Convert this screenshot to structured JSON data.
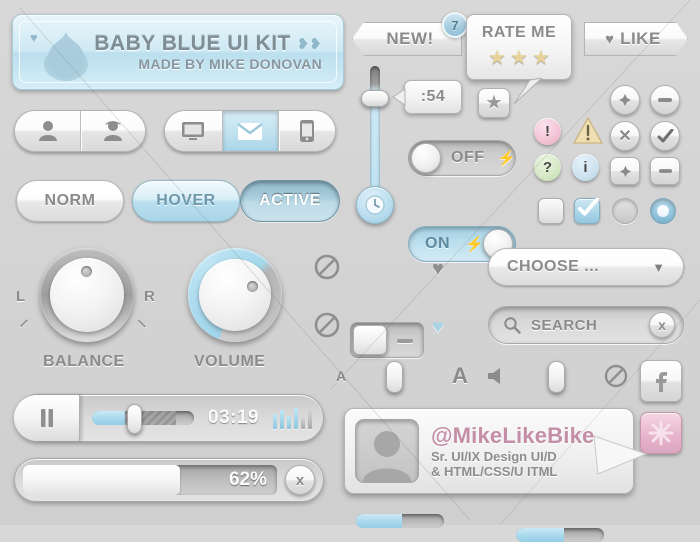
{
  "banner": {
    "title": "BABY BLUE UI KIT",
    "subtitle": "MADE BY MIKE DONOVAN",
    "heart_left": "heart-icon",
    "heart_right": "hearts-icon"
  },
  "tags": {
    "new_label": "NEW!",
    "new_badge": "7",
    "like_label": "LIKE",
    "like_heart": "♥"
  },
  "rate_popover": {
    "title": "RATE ME",
    "stars": [
      "★",
      "★",
      "★"
    ],
    "trigger_icon": "star-icon"
  },
  "timer": {
    "tooltip": ":54",
    "clock_icon": "clock-icon"
  },
  "toggles": {
    "off_label": "OFF",
    "on_label": "ON",
    "bolt": "⚡"
  },
  "states": {
    "norm": "NORM",
    "hover": "HOVER",
    "active": "ACTIVE"
  },
  "segments": {
    "users": [
      "user-icon",
      "user-female-icon"
    ],
    "devices": [
      "monitor-icon",
      "envelope-icon",
      "smartphone-icon"
    ],
    "device_active_index": 1
  },
  "knobs": [
    {
      "label": "BALANCE",
      "left_mark": "L",
      "right_mark": "R",
      "value": 50
    },
    {
      "label": "VOLUME",
      "left_mark": "",
      "right_mark": "",
      "value": 72
    }
  ],
  "icon_grid": {
    "circles": [
      "plus-icon",
      "minus-icon",
      "close-icon",
      "check-icon"
    ],
    "squares": [
      "plus-icon",
      "minus-icon"
    ],
    "radios": [
      "radio-off",
      "radio-on"
    ]
  },
  "alerts": [
    {
      "name": "error-icon",
      "glyph": "!",
      "color": "#f2c3d4"
    },
    {
      "name": "warning-icon",
      "glyph": "!",
      "color": "#f0dfb0"
    },
    {
      "name": "help-icon",
      "glyph": "?",
      "color": "#d5e8c4"
    },
    {
      "name": "info-icon",
      "glyph": "i",
      "color": "#cde2ef"
    }
  ],
  "checks": {
    "checkbox_off": "checkbox-unchecked",
    "checkbox_on": "checkbox-checked",
    "radio_off": "radio-unselected",
    "radio_on": "radio-selected"
  },
  "switch_rows": [
    {
      "prohibit_icon": "no-entry-icon",
      "state": "off",
      "heart": "♥"
    },
    {
      "prohibit_icon": "no-entry-icon",
      "state": "on",
      "heart": "♥"
    }
  ],
  "dropdown": {
    "label": "CHOOSE ...",
    "caret": "▼"
  },
  "search": {
    "placeholder": "SEARCH",
    "value": "SEARCH",
    "search_icon": "search-icon",
    "clear_icon": "close-icon",
    "clear_label": "x"
  },
  "font_slider": {
    "small_label": "A",
    "large_label": "A",
    "value": 52
  },
  "volume_slider": {
    "speaker_icon": "speaker-icon",
    "mute_icon": "no-entry-icon",
    "value": 55
  },
  "social": {
    "facebook": "facebook-icon",
    "gift": "gift-icon"
  },
  "player": {
    "pause_icon": "pause-icon",
    "time": "03:19",
    "scrub_value": 32,
    "equalizer_levels": [
      70,
      85,
      60,
      95,
      50,
      80
    ]
  },
  "progress": {
    "percent_label": "62%",
    "value": 62,
    "cancel_label": "x",
    "cancel_icon": "close-icon"
  },
  "profile": {
    "handle": "@MikeLikeBike",
    "role_line_1": "Sr. UI/IX Design UI/D",
    "role_line_2": "& HTML/CSS/U ITML",
    "avatar_icon": "avatar-icon"
  },
  "colors": {
    "accent_blue": "#a9d5e9",
    "accent_blue_dark": "#6f98ab",
    "pink": "#c48fa6",
    "surface": "#d8d8d8",
    "text": "#8b8b8b"
  }
}
